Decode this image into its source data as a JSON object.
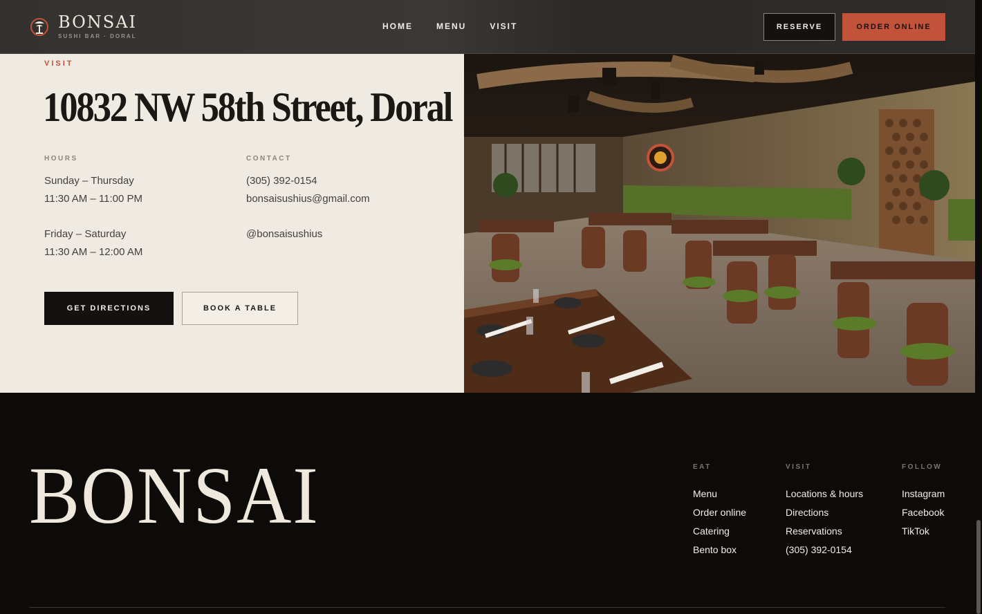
{
  "nav": {
    "brand_name": "BONSAI",
    "brand_sub": "SUSHI BAR · DORAL",
    "links": [
      "HOME",
      "MENU",
      "VISIT"
    ],
    "reserve_label": "RESERVE",
    "order_label": "ORDER ONLINE",
    "accent_color": "#c2533a"
  },
  "visit": {
    "eyebrow": "VISIT",
    "address": "10832 NW 58th Street, Doral",
    "hours": {
      "label": "HOURS",
      "block1_days": "Sunday – Thursday",
      "block1_time": "11:30 AM – 11:00 PM",
      "block2_days": "Friday – Saturday",
      "block2_time": "11:30 AM – 12:00 AM"
    },
    "contact": {
      "label": "CONTACT",
      "phone": "(305) 392-0154",
      "email": "bonsaisushius@gmail.com",
      "social": "@bonsaisushius"
    },
    "directions_label": "GET DIRECTIONS",
    "book_label": "BOOK A TABLE"
  },
  "footer": {
    "brand": "BONSAI",
    "eat": {
      "label": "EAT",
      "links": [
        "Menu",
        "Order online",
        "Catering",
        "Bento box"
      ]
    },
    "visit": {
      "label": "VISIT",
      "links": [
        "Locations & hours",
        "Directions",
        "Reservations",
        "(305) 392-0154"
      ]
    },
    "follow": {
      "label": "FOLLOW",
      "links": [
        "Instagram",
        "Facebook",
        "TikTok"
      ]
    }
  }
}
